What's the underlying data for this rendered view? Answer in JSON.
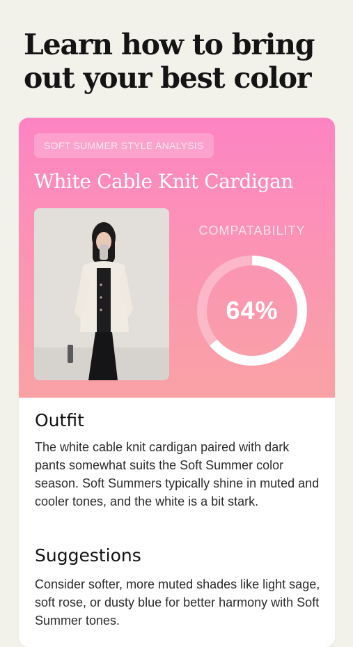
{
  "headline": {
    "line1": "Learn how to bring",
    "line2": "out your best color"
  },
  "card": {
    "tag": "SOFT SUMMER STYLE ANALYSIS",
    "item_title": "White Cable Knit Cardigan",
    "compatibility_label": "COMPATABILITY",
    "compatibility_value": 64,
    "compatibility_text": "64%",
    "outfit": {
      "heading": "Outfit",
      "body": "The white cable knit cardigan paired with dark pants somewhat suits the Soft Summer color season. Soft Summers typically shine in muted and cooler tones, and the white is a bit stark."
    },
    "suggestions": {
      "heading": "Suggestions",
      "body": "Consider softer, more muted shades like light sage, soft rose, or dusty blue for better harmony with Soft Summer tones."
    }
  },
  "colors": {
    "background": "#f2f1ea",
    "gradient_top": "#fd84c3",
    "gradient_bottom": "#f9a2a5",
    "gauge_track": "#fcc3d2",
    "gauge_fill": "#ffffff"
  }
}
